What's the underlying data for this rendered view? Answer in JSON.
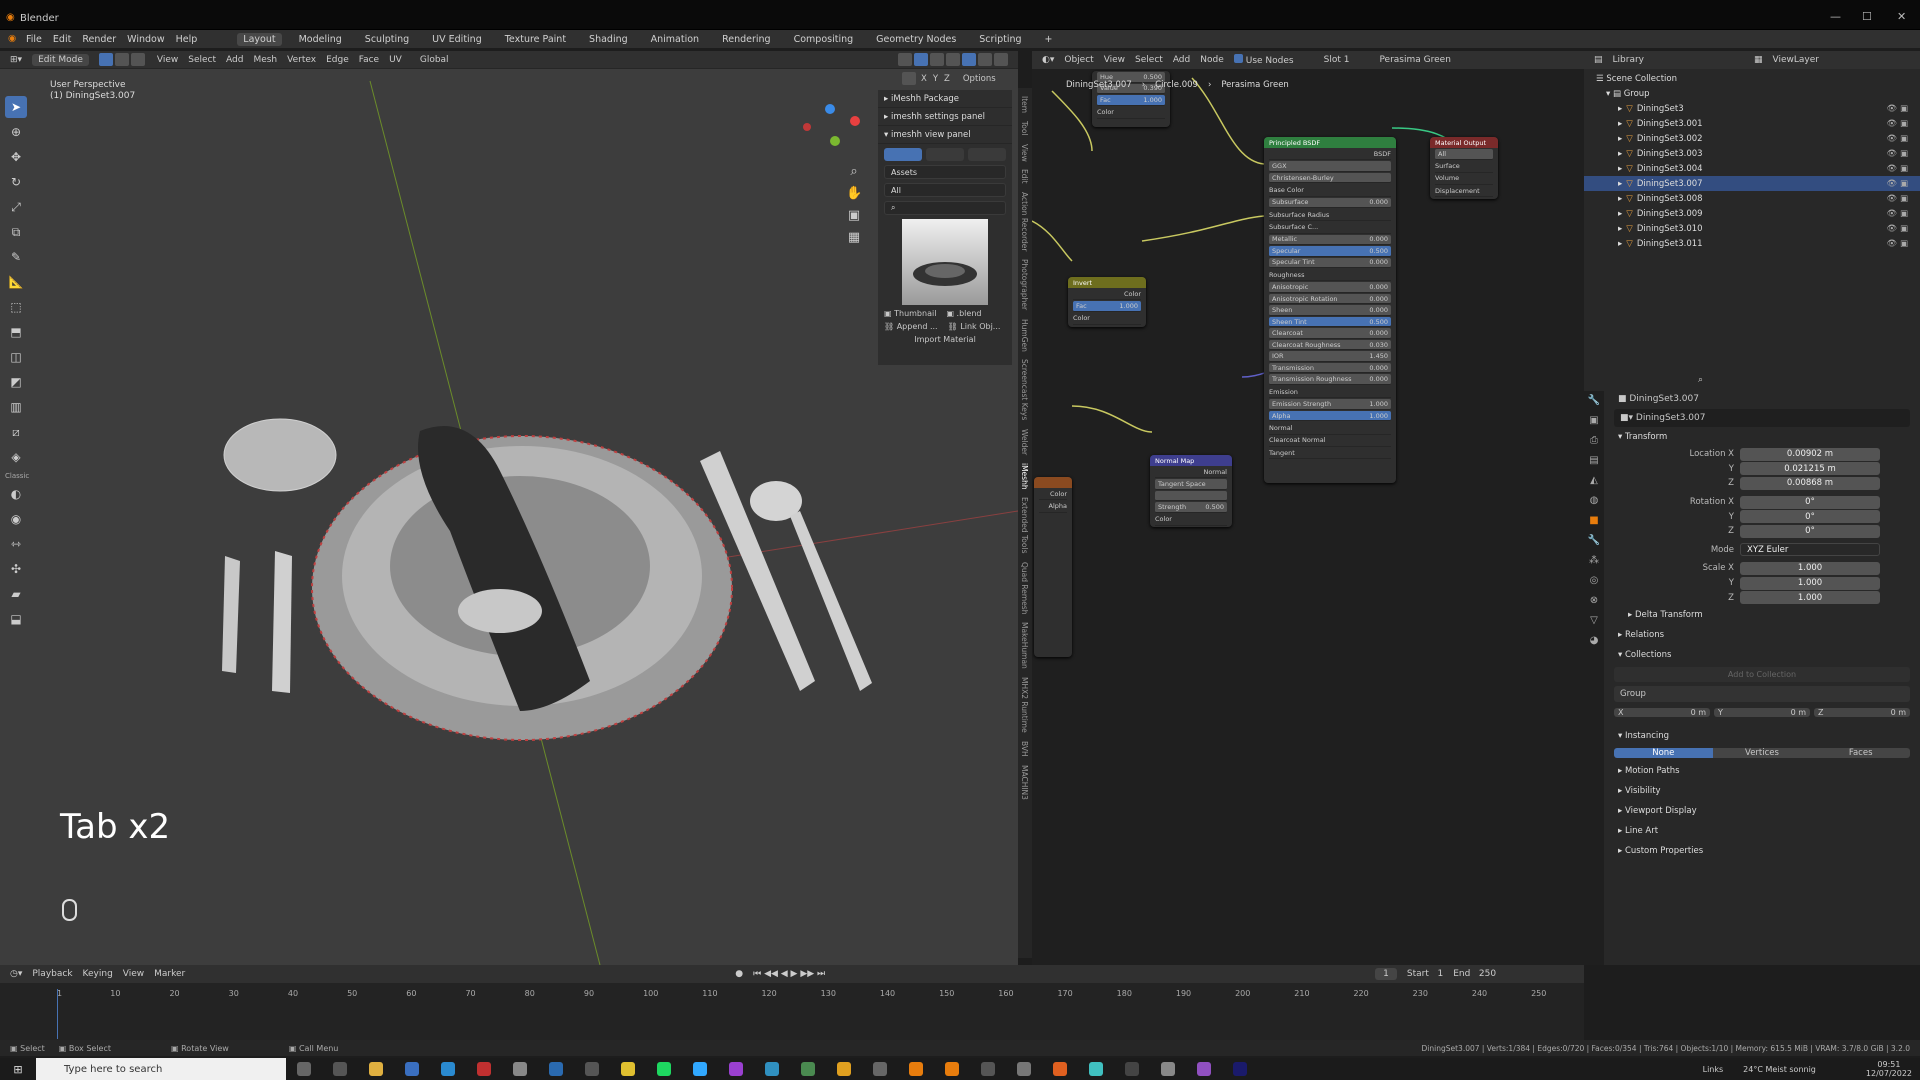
{
  "app": {
    "title": "Blender",
    "min": "—",
    "max": "☐",
    "close": "✕"
  },
  "menu": [
    "File",
    "Edit",
    "Render",
    "Window",
    "Help"
  ],
  "workspaces": [
    "Layout",
    "Modeling",
    "Sculpting",
    "UV Editing",
    "Texture Paint",
    "Shading",
    "Animation",
    "Rendering",
    "Compositing",
    "Geometry Nodes",
    "Scripting",
    "+"
  ],
  "viewport": {
    "mode": "Edit Mode",
    "menus": [
      "View",
      "Select",
      "Add",
      "Mesh",
      "Vertex",
      "Edge",
      "Face",
      "UV"
    ],
    "orientation": "Global",
    "info1": "User Perspective",
    "info2": "(1) DiningSet3.007",
    "overlay_key": "Tab x2",
    "options": "Options",
    "axes": [
      "X",
      "Y",
      "Z"
    ],
    "tool_label": "Classic"
  },
  "npanel": {
    "items": [
      "iMeshh Package",
      "imeshh settings panel",
      "imeshh view panel"
    ],
    "assets": "Assets",
    "all": "All",
    "thumbnail": "Thumbnail",
    "blend": ".blend",
    "append": "Append ...",
    "link": "Link Obj...",
    "import": "Import Material"
  },
  "side_tabs": [
    "Item",
    "Tool",
    "View",
    "Edit",
    "Action Recorder",
    "Photographer",
    "HumGen",
    "Screencast Keys",
    "Welder",
    "iMeshh",
    "Extended Tools",
    "Quad Remesh",
    "MakeHuman",
    "MHX2 Runtime",
    "BVH",
    "MACHIN3"
  ],
  "nodeeditor": {
    "type": "Object",
    "menus": [
      "View",
      "Select",
      "Add",
      "Node"
    ],
    "use_nodes": "Use Nodes",
    "slot": "Slot 1",
    "material": "Perasima Green",
    "breadcrumb": [
      "DiningSet3.007",
      "Circle.009",
      "Perasima Green"
    ]
  },
  "nodes": {
    "hsv": {
      "rows": [
        [
          "Hue",
          "0.500"
        ],
        [
          "Sat",
          ""
        ],
        [
          "Value",
          "0.390"
        ],
        [
          "Fac",
          "1.000"
        ],
        [
          "Color",
          ""
        ]
      ]
    },
    "bsdf": {
      "title": "Principled BSDF",
      "out": "BSDF",
      "dist": "GGX",
      "sss_method": "Christensen-Burley",
      "rows": [
        [
          "Base Color",
          ""
        ],
        [
          "Subsurface",
          "0.000"
        ],
        [
          "Subsurface Radius",
          ""
        ],
        [
          "Subsurface C...",
          ""
        ],
        [
          "Metallic",
          "0.000"
        ],
        [
          "Specular",
          "0.500"
        ],
        [
          "Specular Tint",
          "0.000"
        ],
        [
          "Roughness",
          ""
        ],
        [
          "Anisotropic",
          "0.000"
        ],
        [
          "Anisotropic Rotation",
          "0.000"
        ],
        [
          "Sheen",
          "0.000"
        ],
        [
          "Sheen Tint",
          "0.500"
        ],
        [
          "Clearcoat",
          "0.000"
        ],
        [
          "Clearcoat Roughness",
          "0.030"
        ],
        [
          "IOR",
          "1.450"
        ],
        [
          "Transmission",
          "0.000"
        ],
        [
          "Transmission Roughness",
          "0.000"
        ],
        [
          "Emission",
          ""
        ],
        [
          "Emission Strength",
          "1.000"
        ],
        [
          "Alpha",
          "1.000"
        ],
        [
          "Normal",
          ""
        ],
        [
          "Clearcoat Normal",
          ""
        ],
        [
          "Tangent",
          ""
        ]
      ]
    },
    "output": {
      "title": "Material Output",
      "target": "All",
      "rows": [
        "Surface",
        "Volume",
        "Displacement"
      ]
    },
    "invert": {
      "title": "Invert",
      "rows": [
        [
          "Color",
          ""
        ],
        [
          "Fac",
          "1.000"
        ],
        [
          "Color",
          ""
        ]
      ]
    },
    "normal": {
      "title": "Normal Map",
      "out": "Normal",
      "space": "Tangent Space",
      "rows": [
        [
          "Strength",
          "0.500"
        ],
        [
          "Color",
          ""
        ]
      ]
    },
    "img": {
      "rows": [
        "Color",
        "Alpha"
      ]
    }
  },
  "outliner": {
    "title": "Library",
    "viewlayer": "ViewLayer",
    "root": "Scene Collection",
    "group": "Group",
    "items": [
      "DiningSet3",
      "DiningSet3.001",
      "DiningSet3.002",
      "DiningSet3.003",
      "DiningSet3.004",
      "DiningSet3.007",
      "DiningSet3.008",
      "DiningSet3.009",
      "DiningSet3.010",
      "DiningSet3.011"
    ],
    "selected_index": 5
  },
  "properties": {
    "object": "DiningSet3.007",
    "name": "DiningSet3.007",
    "transform": "Transform",
    "loc_label": "Location X",
    "loc": [
      "0.00902 m",
      "0.021215 m",
      "0.00868 m"
    ],
    "rot_label": "Rotation X",
    "rot": [
      "0°",
      "0°",
      "0°"
    ],
    "mode_label": "Mode",
    "mode": "XYZ Euler",
    "scale_label": "Scale X",
    "scale": [
      "1.000",
      "1.000",
      "1.000"
    ],
    "y": "Y",
    "z": "Z",
    "sections": [
      "Delta Transform",
      "Relations",
      "Collections"
    ],
    "add_collection": "Add to Collection",
    "coll_name": "Group",
    "coll_xyz": [
      "X",
      "0 m",
      "Y",
      "0 m",
      "Z",
      "0 m"
    ],
    "instancing": "Instancing",
    "inst_opts": [
      "None",
      "Vertices",
      "Faces"
    ],
    "more": [
      "Motion Paths",
      "Visibility",
      "Viewport Display",
      "Line Art",
      "Custom Properties"
    ]
  },
  "timeline": {
    "menus": [
      "Playback",
      "Keying",
      "View",
      "Marker"
    ],
    "frame": "1",
    "start_label": "Start",
    "start": "1",
    "end_label": "End",
    "end": "250",
    "ticks": [
      "1",
      "10",
      "20",
      "30",
      "40",
      "50",
      "60",
      "70",
      "80",
      "90",
      "100",
      "110",
      "120",
      "130",
      "140",
      "150",
      "160",
      "170",
      "180",
      "190",
      "200",
      "210",
      "220",
      "230",
      "240",
      "250"
    ]
  },
  "status": {
    "select": "Select",
    "box": "Box Select",
    "rotate": "Rotate View",
    "menu": "Call Menu",
    "stats": "DiningSet3.007 | Verts:1/384 | Edges:0/720 | Faces:0/354 | Tris:764 | Objects:1/10 | Memory: 615.5 MiB | VRAM: 3.7/8.0 GiB | 3.2.0"
  },
  "taskbar": {
    "search": "Type here to search",
    "links": "Links",
    "weather": "24°C  Meist sonnig",
    "time": "09:51",
    "date": "12/07/2022"
  }
}
